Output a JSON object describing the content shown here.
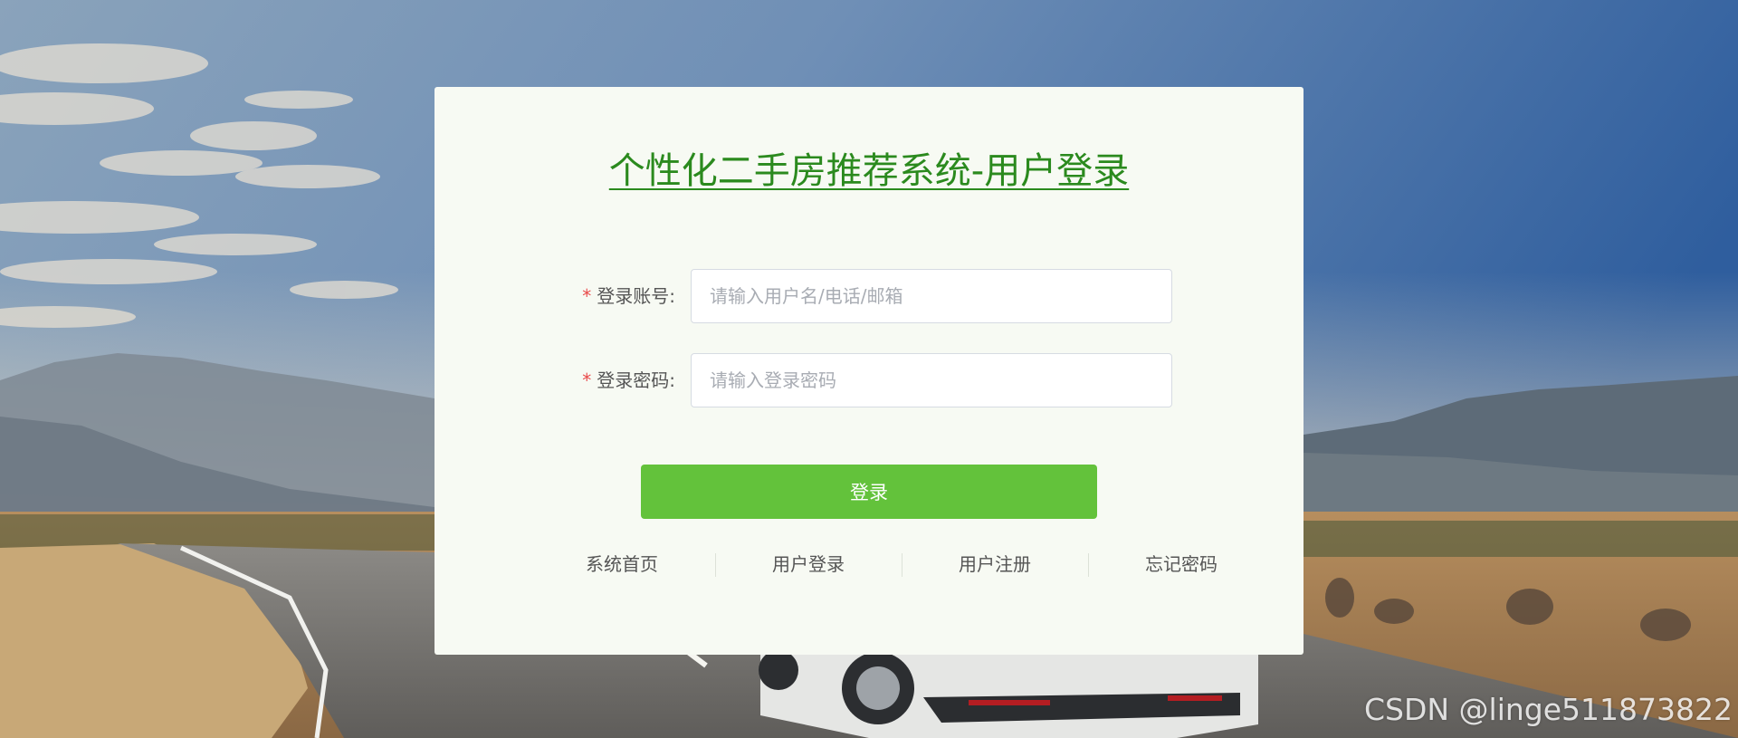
{
  "login_card": {
    "title": "个性化二手房推荐系统-用户登录",
    "account": {
      "required_mark": "*",
      "label": "登录账号:",
      "value": "",
      "placeholder": "请输入用户名/电话/邮箱"
    },
    "password": {
      "required_mark": "*",
      "label": "登录密码:",
      "value": "",
      "placeholder": "请输入登录密码"
    },
    "login_button_label": "登录",
    "links": [
      {
        "label": "系统首页"
      },
      {
        "label": "用户登录"
      },
      {
        "label": "用户注册"
      },
      {
        "label": "忘记密码"
      }
    ]
  },
  "watermark": "CSDN @linge511873822",
  "colors": {
    "title": "#2b8a1e",
    "button": "#63c23b",
    "card_background": "#f7faf3",
    "required_mark": "#e94a4a"
  }
}
